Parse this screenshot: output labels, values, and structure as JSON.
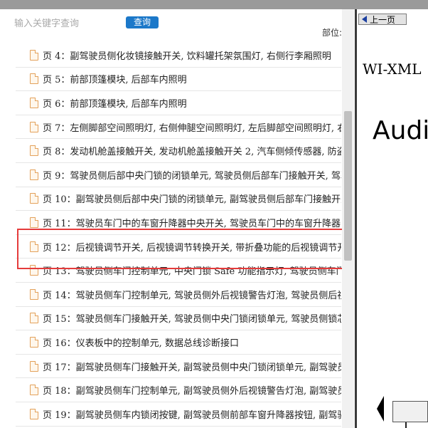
{
  "search": {
    "placeholder": "输入关键字查询",
    "query_button": "查询",
    "partial_label": "部位:"
  },
  "list": {
    "items": [
      {
        "label": "页 4：副驾驶员侧化妆镜接触开关, 饮料罐托架氛围灯, 右侧行李厢照明"
      },
      {
        "label": "页 5：前部顶篷模块, 后部车内照明"
      },
      {
        "label": "页 6：前部顶篷模块, 后部车内照明"
      },
      {
        "label": "页 7：左侧脚部空间照明灯, 右侧伸腿空间照明灯, 左后脚部空间照明灯, 右"
      },
      {
        "label": "页 8：发动机舱盖接触开关, 发动机舱盖接触开关 2, 汽车侧倾传感器, 防盗装"
      },
      {
        "label": "页 9：驾驶员侧后部中央门锁的闭锁单元, 驾驶员侧后部车门接触开关, 驾驶"
      },
      {
        "label": "页 10：副驾驶员侧后部中央门锁的闭锁单元, 副驾驶员侧后部车门接触开关"
      },
      {
        "label": "页 11：驾驶员车门中的车窗升降器中央开关, 驾驶员车门中的车窗升降器"
      },
      {
        "label": "页 12：后视镜调节开关, 后视镜调节转换开关, 带折叠功能的后视镜调节开"
      },
      {
        "label": "页 13：驾驶员侧车门控制单元, 中央门锁 Safe 功能指示灯, 驾驶员侧车门内"
      },
      {
        "label": "页 14：驾驶员侧车门控制单元, 驾驶员侧外后视镜警告灯泡, 驾驶员侧后视"
      },
      {
        "label": "页 15：驾驶员侧车门接触开关, 驾驶员侧中央门锁闭锁单元, 驾驶员侧锁芯"
      },
      {
        "label": "页 16：仪表板中的控制单元, 数据总线诊断接口"
      },
      {
        "label": "页 17：副驾驶员侧车门接触开关, 副驾驶员侧中央门锁闭锁单元, 副驾驶员"
      },
      {
        "label": "页 18：副驾驶员侧车门控制单元, 副驾驶员侧外后视镜警告灯泡, 副驾驶员"
      },
      {
        "label": "页 19：副驾驶员侧车内锁闭按键, 副驾驶员侧前部车窗升降器按钮, 副驾驶"
      }
    ]
  },
  "viewer": {
    "prev_button": "上一页",
    "doc_code": "WI-XML",
    "brand": "Audi"
  },
  "colors": {
    "query_button": "#1c78c9",
    "highlight": "#e53b3b",
    "doc_icon": "#e3a15a"
  }
}
